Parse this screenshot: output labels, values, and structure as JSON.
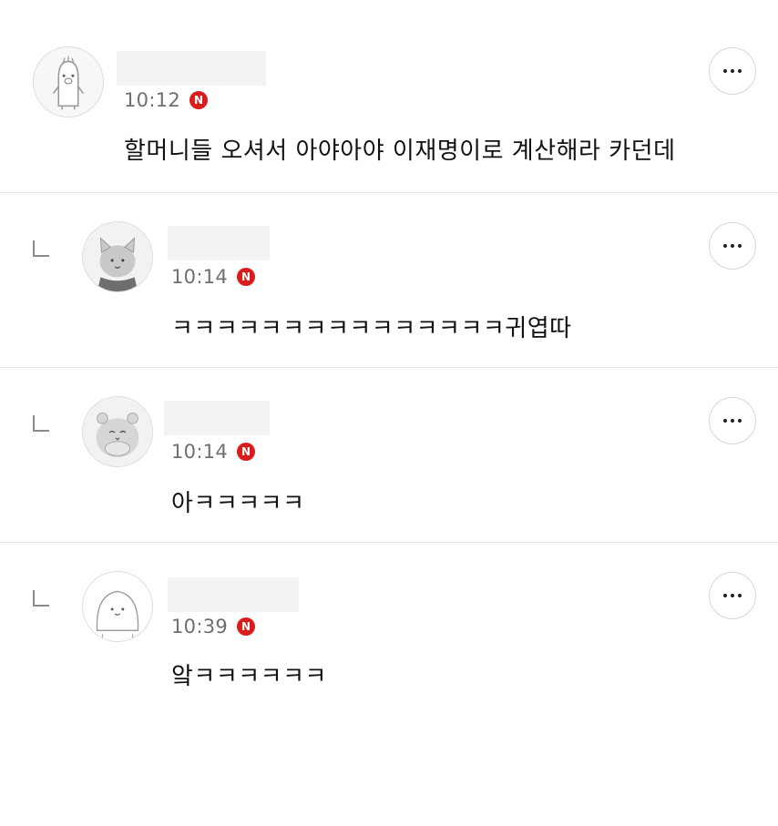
{
  "comments": [
    {
      "time": "10:12",
      "badge": "N",
      "text": "할머니들 오셔서 아야아야 이재명이로 계산해라 카던데",
      "avatar": "penguin-avatar-icon",
      "is_reply": false
    },
    {
      "time": "10:14",
      "badge": "N",
      "text": "ㅋㅋㅋㅋㅋㅋㅋㅋㅋㅋㅋㅋㅋㅋㅋ귀엽따",
      "avatar": "cat-avatar-icon",
      "is_reply": true
    },
    {
      "time": "10:14",
      "badge": "N",
      "text": "아ㅋㅋㅋㅋㅋ",
      "avatar": "hamster-avatar-icon",
      "is_reply": true
    },
    {
      "time": "10:39",
      "badge": "N",
      "text": "앜ㅋㅋㅋㅋㅋㅋ",
      "avatar": "blob-avatar-icon",
      "is_reply": true
    }
  ],
  "colors": {
    "badge": "#d91c1c",
    "divider": "#e6e6e6",
    "time": "#6f6f6f"
  }
}
